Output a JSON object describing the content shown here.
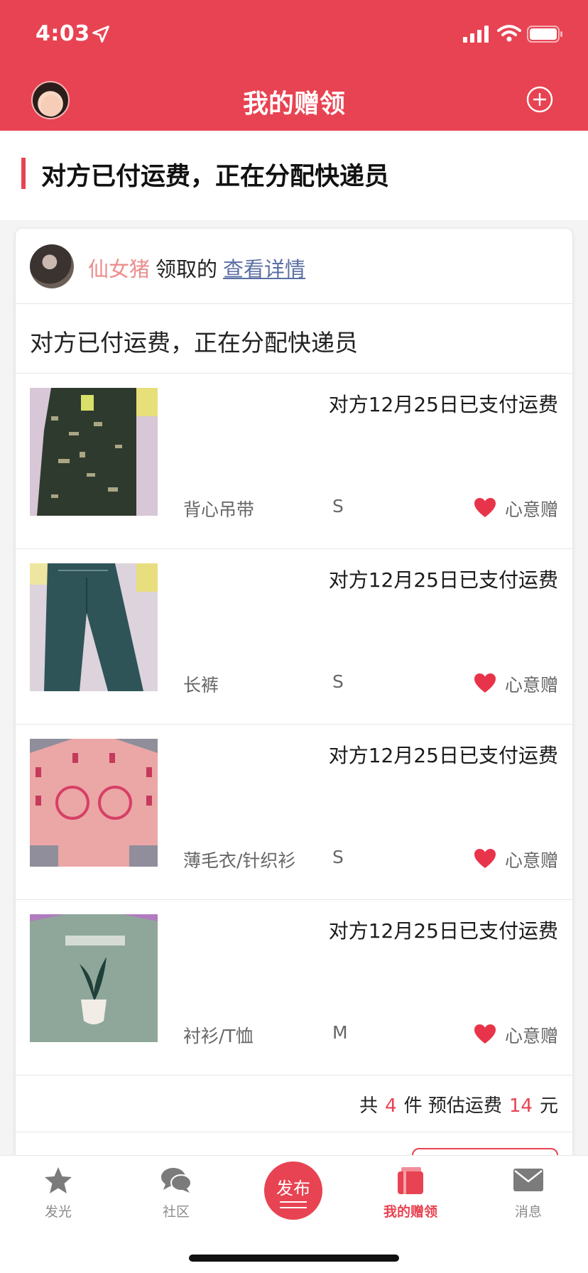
{
  "status_bar": {
    "time": "4:03"
  },
  "header": {
    "title": "我的赠领"
  },
  "section": {
    "title": "对方已付运费，正在分配快递员"
  },
  "claim": {
    "claimer_name": "仙女猪",
    "verb": "领取的",
    "detail_link": "查看详情",
    "status": "对方已付运费，正在分配快递员"
  },
  "items": [
    {
      "paid": "对方12月25日已支付运费",
      "name": "背心吊带",
      "size": "S",
      "gift_type": "心意赠"
    },
    {
      "paid": "对方12月25日已支付运费",
      "name": "长裤",
      "size": "S",
      "gift_type": "心意赠"
    },
    {
      "paid": "对方12月25日已支付运费",
      "name": "薄毛衣/针织衫",
      "size": "S",
      "gift_type": "心意赠"
    },
    {
      "paid": "对方12月25日已支付运费",
      "name": "衬衫/T恤",
      "size": "M",
      "gift_type": "心意赠"
    }
  ],
  "summary": {
    "prefix": "共",
    "count": "4",
    "count_unit": "件 预估运费",
    "fee": "14",
    "fee_unit": "元"
  },
  "tabs": [
    {
      "label": "发光",
      "icon": "star-icon"
    },
    {
      "label": "社区",
      "icon": "chat-bubbles-icon"
    },
    {
      "label": "发布",
      "icon": "publish-icon"
    },
    {
      "label": "我的赠领",
      "icon": "gift-book-icon",
      "active": true
    },
    {
      "label": "消息",
      "icon": "mail-icon"
    }
  ],
  "colors": {
    "brand": "#e84352",
    "link": "#5a6fa3",
    "claimer": "#ec8d8d"
  }
}
